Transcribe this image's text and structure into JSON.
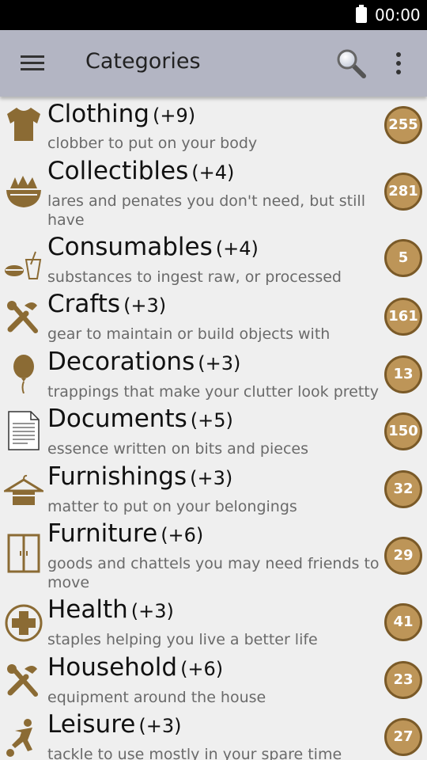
{
  "status_bar": {
    "time": "00:00"
  },
  "app_bar": {
    "title": "Categories",
    "menu_icon": "menu-icon",
    "search_icon": "search-icon",
    "overflow_icon": "more-vert-icon"
  },
  "colors": {
    "accent": "#8b6b34",
    "badge": "#bd9558",
    "app_bar": "#b3b5c3"
  },
  "categories": [
    {
      "name": "Clothing",
      "delta": "(+9)",
      "description": "clobber to put on your body",
      "count": "255",
      "icon": "shirt-icon"
    },
    {
      "name": "Collectibles",
      "delta": "(+4)",
      "description": "lares and penates you don't need, but still have",
      "count": "281",
      "icon": "bowl-icon"
    },
    {
      "name": "Consumables",
      "delta": "(+4)",
      "description": "substances to ingest raw, or processed",
      "count": "5",
      "icon": "food-drink-icon"
    },
    {
      "name": "Crafts",
      "delta": "(+3)",
      "description": "gear to maintain or build objects with",
      "count": "161",
      "icon": "tools-icon"
    },
    {
      "name": "Decorations",
      "delta": "(+3)",
      "description": "trappings that make your clutter look pretty",
      "count": "13",
      "icon": "balloon-icon"
    },
    {
      "name": "Documents",
      "delta": "(+5)",
      "description": "essence written on bits and pieces",
      "count": "150",
      "icon": "document-icon"
    },
    {
      "name": "Furnishings",
      "delta": "(+3)",
      "description": "matter to put on your belongings",
      "count": "32",
      "icon": "hanger-icon"
    },
    {
      "name": "Furniture",
      "delta": "(+6)",
      "description": "goods and chattels you may need friends to move",
      "count": "29",
      "icon": "wardrobe-icon"
    },
    {
      "name": "Health",
      "delta": "(+3)",
      "description": "staples helping you live a better life",
      "count": "41",
      "icon": "health-cross-icon"
    },
    {
      "name": "Household",
      "delta": "(+6)",
      "description": "equipment around the house",
      "count": "23",
      "icon": "tools-icon"
    },
    {
      "name": "Leisure",
      "delta": "(+3)",
      "description": "tackle to use mostly in your spare time",
      "count": "27",
      "icon": "soccer-player-icon"
    }
  ]
}
